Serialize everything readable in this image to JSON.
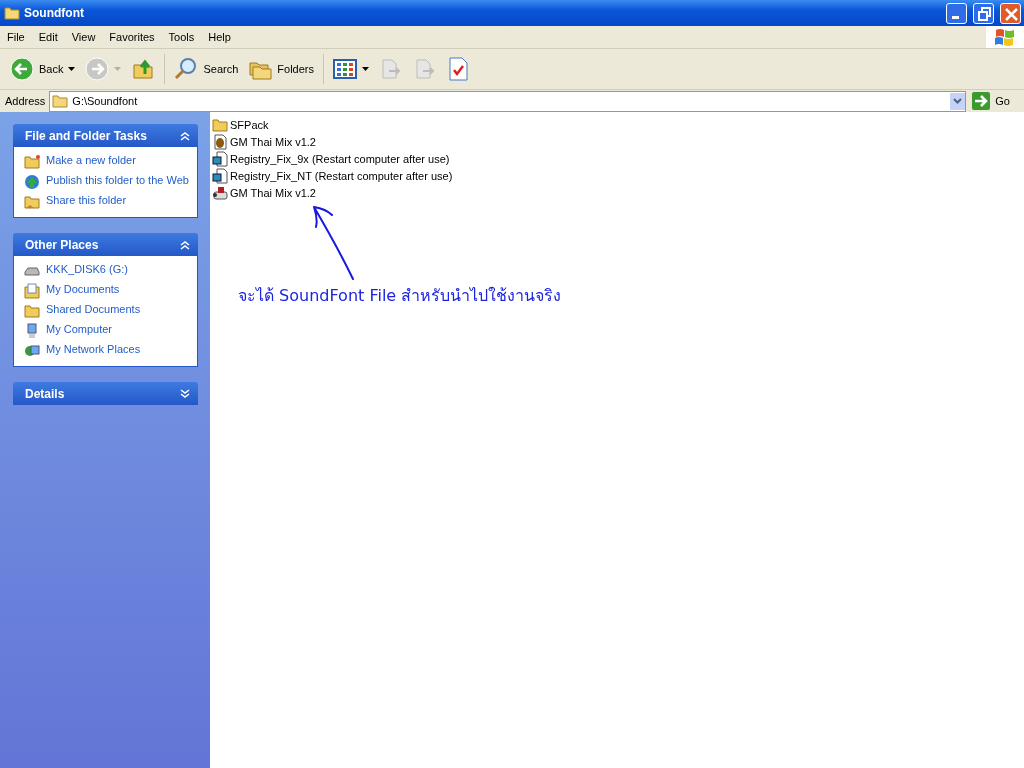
{
  "window": {
    "title": "Soundfont"
  },
  "menu": [
    "File",
    "Edit",
    "View",
    "Favorites",
    "Tools",
    "Help"
  ],
  "toolbar": [
    {
      "kind": "back",
      "label": "Back",
      "disabled": false
    },
    {
      "kind": "forward",
      "disabled": true
    },
    {
      "kind": "up",
      "disabled": false
    },
    {
      "kind": "search",
      "label": "Search",
      "disabled": false
    },
    {
      "kind": "folders",
      "label": "Folders",
      "disabled": false
    },
    {
      "kind": "views",
      "disabled": false
    },
    {
      "kind": "move",
      "disabled": true
    },
    {
      "kind": "copy",
      "disabled": true
    },
    {
      "kind": "properties",
      "disabled": false
    }
  ],
  "address": {
    "label": "Address",
    "value": "G:\\Soundfont",
    "go": "Go"
  },
  "panels": [
    {
      "title": "File and Folder Tasks",
      "expanded": true,
      "items": [
        {
          "kind": "newfolder",
          "label": "Make a new folder"
        },
        {
          "kind": "publish",
          "label": "Publish this folder to the Web"
        },
        {
          "kind": "share",
          "label": "Share this folder"
        }
      ]
    },
    {
      "title": "Other Places",
      "expanded": true,
      "items": [
        {
          "kind": "drive",
          "label": "KKK_DISK6 (G:)"
        },
        {
          "kind": "documents",
          "label": "My Documents"
        },
        {
          "kind": "folder",
          "label": "Shared Documents"
        },
        {
          "kind": "computer",
          "label": "My Computer"
        },
        {
          "kind": "network",
          "label": "My Network Places"
        }
      ]
    },
    {
      "title": "Details",
      "expanded": false
    }
  ],
  "files": [
    {
      "kind": "folder",
      "name": "SFPack"
    },
    {
      "kind": "app",
      "name": "GM Thai Mix v1.2"
    },
    {
      "kind": "registry",
      "name": "Registry_Fix_9x (Restart computer after use)"
    },
    {
      "kind": "registry",
      "name": "Registry_Fix_NT (Restart computer after use)"
    },
    {
      "kind": "soundfont",
      "name": "GM Thai Mix v1.2"
    }
  ],
  "annotation": "จะได้ SoundFont File สำหรับนำไปใช้งานจริง"
}
